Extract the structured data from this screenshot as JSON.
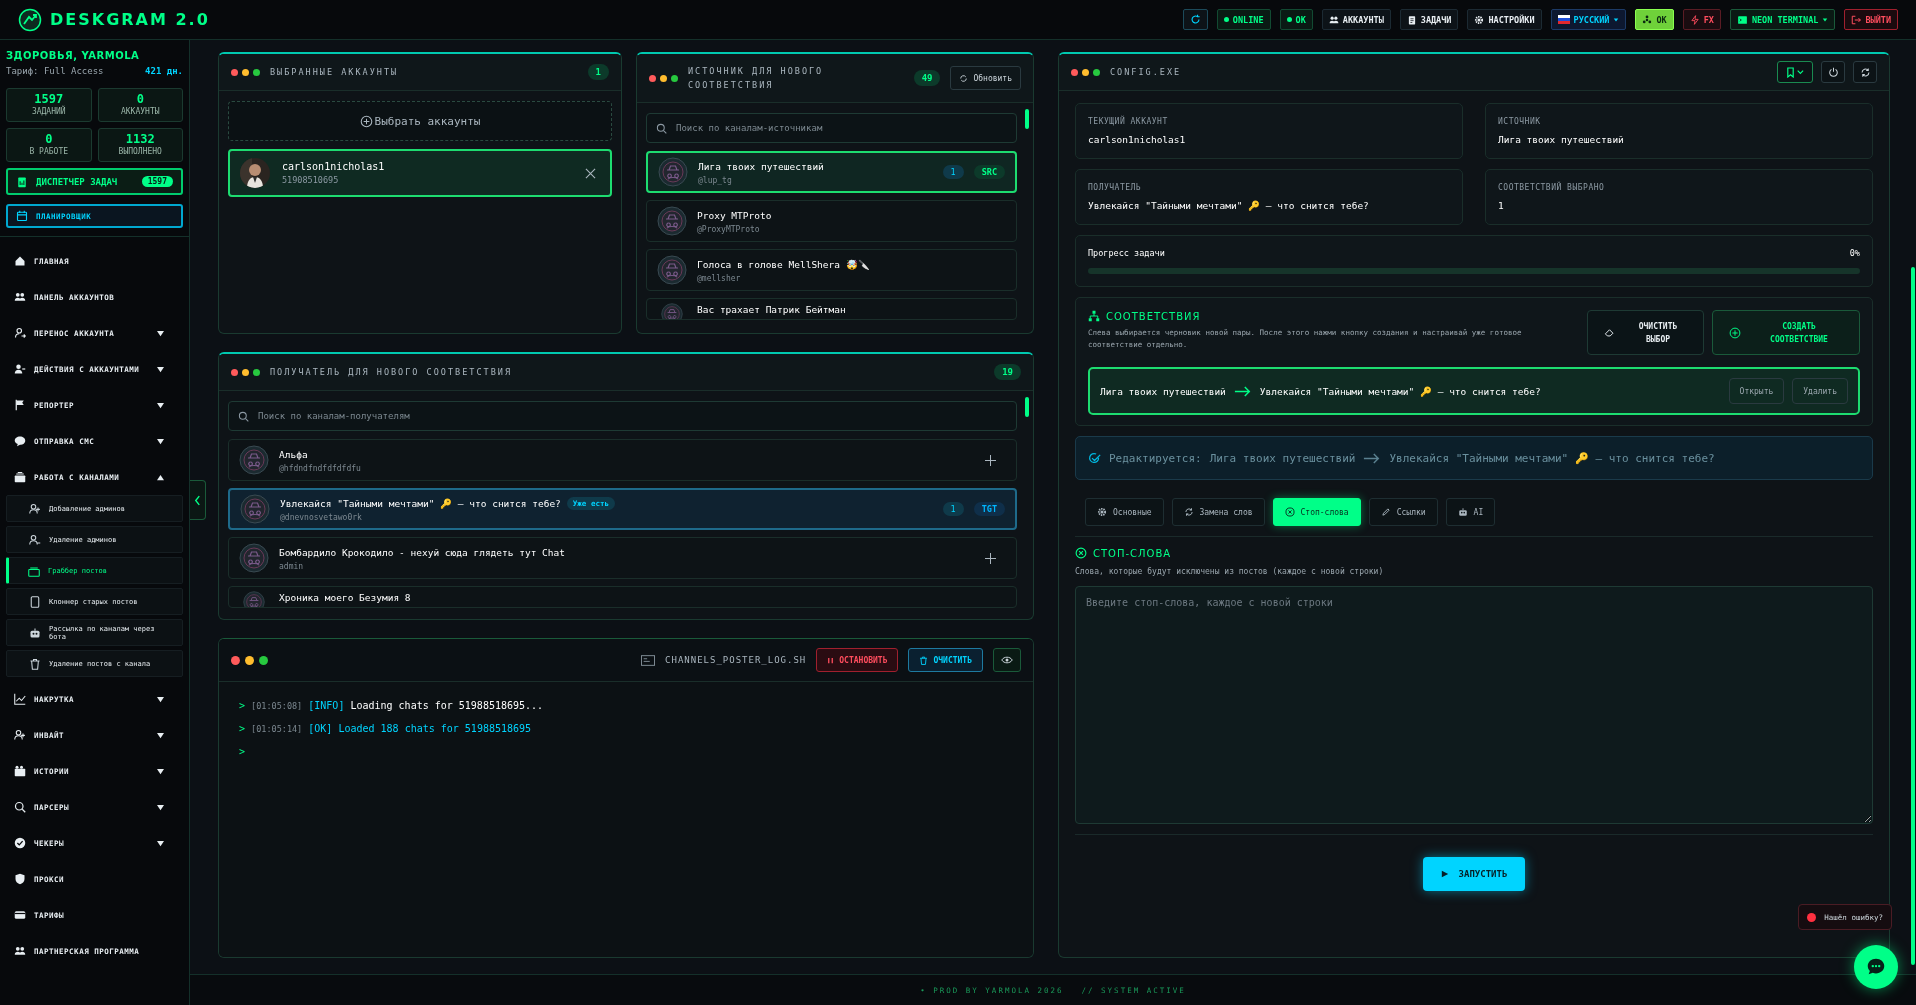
{
  "app": {
    "title": "DESKGRAM 2.0"
  },
  "topbar": [
    {
      "kind": "status",
      "label": "ONLINE"
    },
    {
      "kind": "status",
      "label": "OK"
    },
    {
      "kind": "nav",
      "label": "АККАУНТЫ"
    },
    {
      "kind": "nav",
      "label": "ЗАДАЧИ"
    },
    {
      "kind": "nav",
      "label": "НАСТРОЙКИ"
    },
    {
      "kind": "lang",
      "label": "РУССКИЙ"
    },
    {
      "kind": "ok",
      "label": "OK"
    },
    {
      "kind": "fx",
      "label": "FX"
    },
    {
      "kind": "theme",
      "label": "NEON TERMINAL"
    },
    {
      "kind": "logout",
      "label": "ВЫЙТИ"
    }
  ],
  "sidebar": {
    "greeting": "ЗДОРОВЬЯ, YARMOLA",
    "plan": "Тариф: Full Access",
    "days": "421 дн.",
    "stats": [
      {
        "value": "1597",
        "label": "ЗАДАНИЙ"
      },
      {
        "value": "0",
        "label": "АККАУНТЫ"
      },
      {
        "value": "0",
        "label": "В РАБОТЕ"
      },
      {
        "value": "1132",
        "label": "ВЫПОЛНЕНО"
      }
    ],
    "task_manager": {
      "label": "ДИСПЕТЧЕР ЗАДАЧ",
      "badge": "1597"
    },
    "scheduler": {
      "label": "ПЛАНИРОВЩИК"
    },
    "items": [
      {
        "kind": "link",
        "label": "ГЛАВНАЯ"
      },
      {
        "kind": "link",
        "label": "ПАНЕЛЬ АККАУНТОВ"
      },
      {
        "kind": "group",
        "label": "ПЕРЕНОС АККАУНТА",
        "expanded": false
      },
      {
        "kind": "group",
        "label": "ДЕЙСТВИЯ С АККАУНТАМИ",
        "expanded": false
      },
      {
        "kind": "group",
        "label": "РЕПОРТЕР",
        "expanded": false
      },
      {
        "kind": "group",
        "label": "ОТПРАВКА СМС",
        "expanded": false
      },
      {
        "kind": "group",
        "label": "РАБОТА С КАНАЛАМИ",
        "expanded": true,
        "children": [
          {
            "label": "Добавление админов",
            "selected": false
          },
          {
            "label": "Удаление админов",
            "selected": false
          },
          {
            "label": "Граббер постов",
            "selected": true
          },
          {
            "label": "Клоннер старых постов",
            "selected": false
          },
          {
            "label": "Рассылка по каналам через бота",
            "selected": false
          },
          {
            "label": "Удаление постов с канала",
            "selected": false
          }
        ]
      },
      {
        "kind": "group",
        "label": "НАКРУТКА",
        "expanded": false
      },
      {
        "kind": "group",
        "label": "ИНВАЙТ",
        "expanded": false
      },
      {
        "kind": "group",
        "label": "ИСТОРИИ",
        "expanded": false
      },
      {
        "kind": "group",
        "label": "ПАРСЕРЫ",
        "expanded": false
      },
      {
        "kind": "group",
        "label": "ЧЕКЕРЫ",
        "expanded": false
      },
      {
        "kind": "link",
        "label": "ПРОКСИ"
      },
      {
        "kind": "link",
        "label": "ТАРИФЫ"
      },
      {
        "kind": "link",
        "label": "ПАРТНЕРСКАЯ ПРОГРАММА"
      }
    ]
  },
  "accounts_panel": {
    "title": "ВЫБРАННЫЕ АККАУНТЫ",
    "count": "1",
    "pick_button": "Выбрать аккаунты",
    "accounts": [
      {
        "name": "carlson1nicholas1",
        "id": "51908510695",
        "selected": true
      }
    ]
  },
  "source_panel": {
    "title": "ИСТОЧНИК ДЛЯ НОВОГО СООТВЕТСТВИЯ",
    "count": "49",
    "refresh": "Обновить",
    "search": {
      "placeholder": "Поиск по каналам-источникам"
    },
    "channels": [
      {
        "name": "Лига твоих путешествий",
        "handle": "@lup_tg",
        "selected": true,
        "count": "1",
        "tag": "SRC"
      },
      {
        "name": "Proxy MTProto",
        "handle": "@ProxyMTProto",
        "selected": false
      },
      {
        "name": "Голоса в голове MellShera 🤯🔪",
        "handle": "@mellsher",
        "selected": false
      },
      {
        "name": "Вас трахает Патрик Бейтман",
        "selected": false
      }
    ]
  },
  "receiver_panel": {
    "title": "ПОЛУЧАТЕЛЬ ДЛЯ НОВОГО СООТВЕТСТВИЯ",
    "count": "19",
    "search": {
      "placeholder": "Поиск по каналам-получателям"
    },
    "channels": [
      {
        "name": "Альфа",
        "handle": "@hfdndfndfdfdfdfu",
        "selected": false
      },
      {
        "name": "Увлекайся \"Тайными мечтами\" 🔑 — что снится тебе?",
        "badge": "Уже есть",
        "handle": "@dnevnosvetawo0rk",
        "selected": true,
        "count": "1",
        "tag": "TGT"
      },
      {
        "name": "Бомбардило Крокодило - нехуй сюда глядеть тут Chat",
        "handle": "admin",
        "selected": false
      },
      {
        "name": "Хроника моего Безумия 8",
        "selected": false
      }
    ]
  },
  "log_panel": {
    "title": "CHANNELS_POSTER_LOG.SH",
    "stop": "ОСТАНОВИТЬ",
    "clear": "ОЧИСТИТЬ",
    "prompt": ">",
    "lines": [
      {
        "kind": "info",
        "time": "[01:05:08]",
        "level": "[INFO]",
        "text": "Loading chats for 51988518695..."
      },
      {
        "kind": "ok",
        "time": "[01:05:14]",
        "level": "[OK]",
        "text": "Loaded 188 chats for 51988518695"
      }
    ]
  },
  "config_panel": {
    "title": "CONFIG.EXE",
    "cards": [
      {
        "label": "ТЕКУЩИЙ АККАУНТ",
        "value": "carlson1nicholas1"
      },
      {
        "label": "ИСТОЧНИК",
        "value": "Лига твоих путешествий"
      },
      {
        "label": "ПОЛУЧАТЕЛЬ",
        "value": "Увлекайся \"Тайными мечтами\" 🔑 — что снится тебе?"
      },
      {
        "label": "СООТВЕТСТВИЙ ВЫБРАНО",
        "value": "1"
      }
    ],
    "progress": {
      "label": "Прогресс задачи",
      "reading": "0%",
      "level": 0
    },
    "matches": {
      "title": "СООТВЕТСТВИЯ",
      "description": "Слева выбирается черновик новой пары. После этого нажми кнопку создания и настраивай уже готовое соответствие отдельно.",
      "clear_button": "ОЧИСТИТЬ ВЫБОР",
      "create_button": "СОЗДАТЬ СООТВЕТСТВИЕ",
      "pairs": [
        {
          "source": "Лига твоих путешествий",
          "target": "Увлекайся \"Тайными мечтами\" 🔑 — что снится тебе?",
          "selected": true,
          "open": "Открыть",
          "delete": "Удалить"
        }
      ]
    },
    "editing": {
      "label": "Редактируется:",
      "source": "Лига твоих путешествий",
      "target": "Увлекайся \"Тайными мечтами\" 🔑 — что снится тебе?"
    },
    "tabs": [
      {
        "kind": "settings",
        "label": "Основные",
        "selected": false
      },
      {
        "kind": "replace",
        "label": "Замена слов",
        "selected": false
      },
      {
        "kind": "stop",
        "label": "Стоп-слова",
        "selected": true
      },
      {
        "kind": "links",
        "label": "Ссылки",
        "selected": false
      },
      {
        "kind": "ai",
        "label": "AI",
        "selected": false
      }
    ],
    "stop_words": {
      "title": "СТОП-СЛОВА",
      "hint": "Слова, которые будут исключены из постов (каждое с новой строки)",
      "placeholder": "Введите стоп-слова, каждое с новой строки"
    },
    "run_button": "ЗАПУСТИТЬ"
  },
  "bug_report": "Нашёл ошибку?",
  "footer": {
    "left": "• PROD BY YARMOLA 2026",
    "right": "// SYSTEM ACTIVE"
  }
}
